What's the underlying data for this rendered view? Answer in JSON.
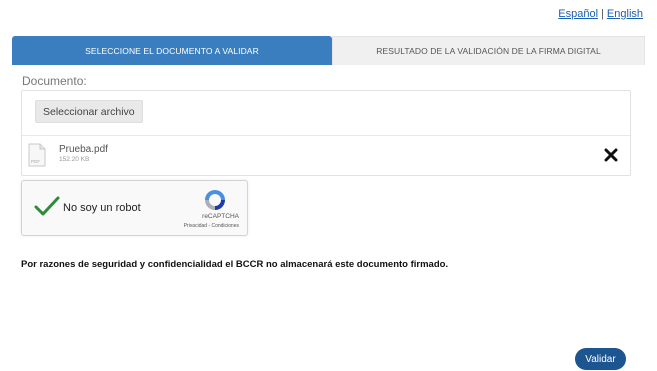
{
  "language": {
    "spanish": "Español",
    "separator": "|",
    "english": "English"
  },
  "tabs": [
    {
      "label": "SELECCIONE EL DOCUMENTO A VALIDAR"
    },
    {
      "label": "RESULTADO DE LA VALIDACIÓN DE LA FIRMA DIGITAL"
    }
  ],
  "upload": {
    "label": "Documento:",
    "select_button": "Seleccionar archivo",
    "file": {
      "name": "Prueba.pdf",
      "size": "152.20 KB",
      "icon_text": "PDF"
    }
  },
  "captcha": {
    "label": "No soy un robot",
    "brand": "reCAPTCHA",
    "links": "Privacidad - Condiciones"
  },
  "notice": "Por razones de seguridad y confidencialidad el BCCR no almacenará este documento firmado.",
  "actions": {
    "validar": "Validar"
  },
  "colors": {
    "tab_active": "#3a7ebf",
    "tab_inactive": "#f0f0f0",
    "validar_button": "#1d5590",
    "link": "#1a5fb4",
    "captcha_check": "#2e8b3a"
  },
  "icons": {
    "file": "file-pdf-icon",
    "remove": "close-icon",
    "check": "checkmark-icon",
    "recaptcha": "recaptcha-logo-icon"
  }
}
